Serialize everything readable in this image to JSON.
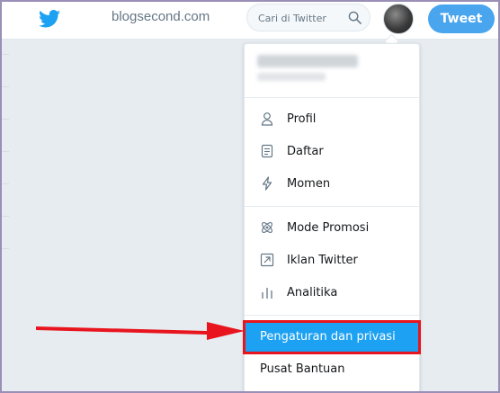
{
  "header": {
    "watermark": "blogsecond.com",
    "search_placeholder": "Cari di Twitter",
    "tweet_label": "Tweet"
  },
  "menu": {
    "items": [
      {
        "label": "Profil",
        "icon": "person-icon"
      },
      {
        "label": "Daftar",
        "icon": "list-icon"
      },
      {
        "label": "Momen",
        "icon": "lightning-icon"
      },
      {
        "label": "Mode Promosi",
        "icon": "atom-icon"
      },
      {
        "label": "Iklan Twitter",
        "icon": "external-arrow-icon"
      },
      {
        "label": "Analitika",
        "icon": "bar-chart-icon"
      }
    ],
    "settings_label": "Pengaturan dan privasi",
    "help_label": "Pusat Bantuan"
  },
  "colors": {
    "twitter_blue": "#1da1f2",
    "highlight_red": "#e8141e",
    "background": "#e6ecf0"
  }
}
